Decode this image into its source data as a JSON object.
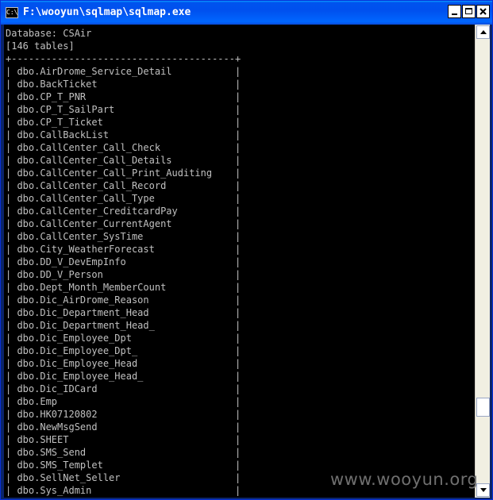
{
  "window": {
    "title": "F:\\wooyun\\sqlmap\\sqlmap.exe",
    "icon_text": "C:\\"
  },
  "console": {
    "lines": [
      "Database: CSAir",
      "[146 tables]",
      "+---------------------------------------+",
      "| dbo.AirDrome_Service_Detail           |",
      "| dbo.BackTicket                        |",
      "| dbo.CP_T_PNR                          |",
      "| dbo.CP_T_SailPart                     |",
      "| dbo.CP_T_Ticket                       |",
      "| dbo.CallBackList                      |",
      "| dbo.CallCenter_Call_Check             |",
      "| dbo.CallCenter_Call_Details           |",
      "| dbo.CallCenter_Call_Print_Auditing    |",
      "| dbo.CallCenter_Call_Record            |",
      "| dbo.CallCenter_Call_Type              |",
      "| dbo.CallCenter_CreditcardPay          |",
      "| dbo.CallCenter_CurrentAgent           |",
      "| dbo.CallCenter_SysTime                |",
      "| dbo.City_WeatherForecast              |",
      "| dbo.DD_V_DevEmpInfo                   |",
      "| dbo.DD_V_Person                       |",
      "| dbo.Dept_Month_MemberCount            |",
      "| dbo.Dic_AirDrome_Reason               |",
      "| dbo.Dic_Department_Head               |",
      "| dbo.Dic_Department_Head_              |",
      "| dbo.Dic_Employee_Dpt                  |",
      "| dbo.Dic_Employee_Dpt_                 |",
      "| dbo.Dic_Employee_Head                 |",
      "| dbo.Dic_Employee_Head_                |",
      "| dbo.Dic_IDCard                        |",
      "| dbo.Emp                               |",
      "| dbo.HK07120802                        |",
      "| dbo.NewMsgSend                        |",
      "| dbo.SHEET                             |",
      "| dbo.SMS_Send                          |",
      "| dbo.SMS_Templet                       |",
      "| dbo.SellNet_Seller                    |",
      "| dbo.Sys_Admin                         |"
    ]
  },
  "watermark": "www.wooyun.org",
  "colors": {
    "console_bg": "#000000",
    "console_text": "#c0c0c0",
    "titlebar": "#0053ee"
  }
}
